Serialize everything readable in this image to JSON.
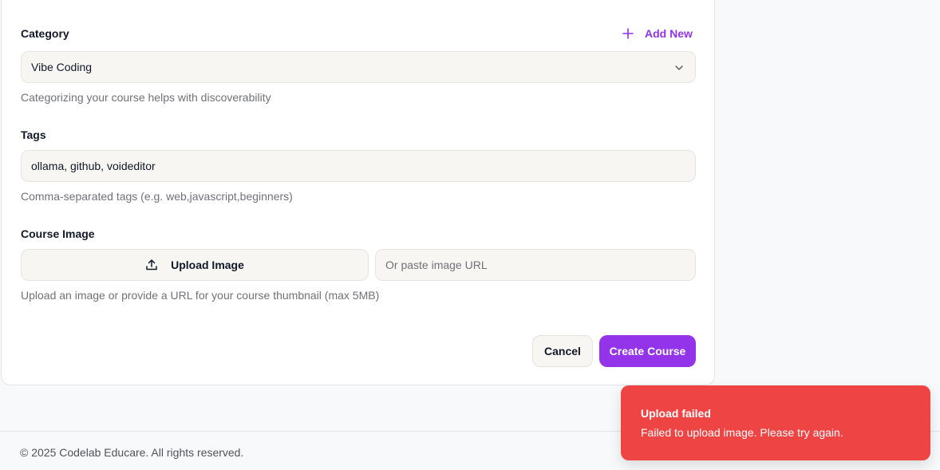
{
  "form": {
    "category": {
      "label": "Category",
      "add_new_label": "Add New",
      "selected_value": "Vibe Coding",
      "helper": "Categorizing your course helps with discoverability"
    },
    "tags": {
      "label": "Tags",
      "value": "ollama, github, voideditor",
      "helper": "Comma-separated tags (e.g. web,javascript,beginners)"
    },
    "course_image": {
      "label": "Course Image",
      "upload_label": "Upload Image",
      "url_placeholder": "Or paste image URL",
      "helper": "Upload an image or provide a URL for your course thumbnail (max 5MB)"
    },
    "actions": {
      "cancel_label": "Cancel",
      "create_label": "Create Course"
    }
  },
  "footer": {
    "copyright": "© 2025 Codelab Educare. All rights reserved."
  },
  "toast": {
    "title": "Upload failed",
    "message": "Failed to upload image. Please try again."
  },
  "colors": {
    "accent": "#9333ea",
    "error": "#ef4444",
    "input_bg": "#f7f6f3"
  },
  "icons": {
    "add": "plus-icon",
    "select": "chevron-down-icon",
    "upload": "upload-icon"
  }
}
